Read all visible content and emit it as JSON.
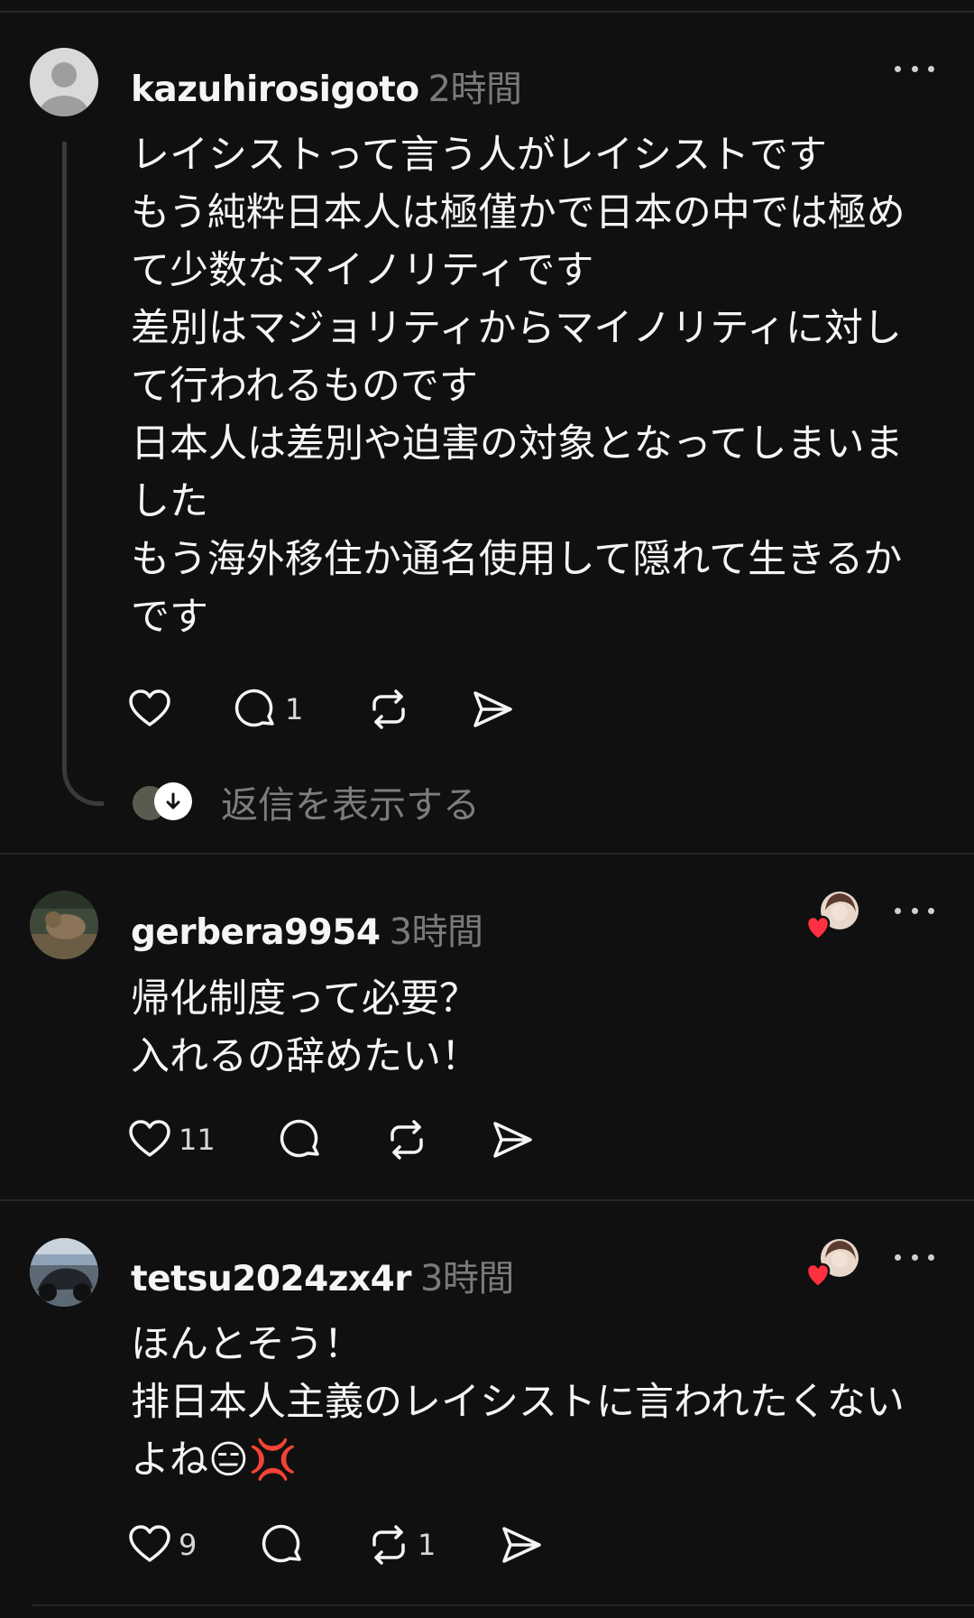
{
  "posts": [
    {
      "username": "kazuhirosigoto",
      "time": "2時間",
      "text": "レイシストって言う人がレイシストです\nもう純粋日本人は極僅かで日本の中では極め\nて少数なマイノリティです\n差別はマジョリティからマイノリティに対し\nて行われるものです\n日本人は差別や迫害の対象となってしまいま\nした\nもう海外移住か通名使用して隠れて生きるか\nです",
      "likes": "",
      "replies": "1",
      "reposts": "",
      "show_replies_label": "返信を表示する"
    },
    {
      "username": "gerbera9954",
      "time": "3時間",
      "text": "帰化制度って必要？\n入れるの辞めたい！",
      "likes": "11",
      "replies": "",
      "reposts": ""
    },
    {
      "username": "tetsu2024zx4r",
      "time": "3時間",
      "text": "ほんとそう！\n排日本人主義のレイシストに言われたくない\nよね😑💢",
      "likes": "9",
      "replies": "",
      "reposts": "1"
    }
  ],
  "icons": [
    "heart-icon",
    "comment-icon",
    "repost-icon",
    "share-icon",
    "more-icon",
    "arrow-down-icon"
  ],
  "colors": {
    "background": "#101010",
    "text": "#f3f5f7",
    "muted": "#7a7a7a",
    "like_red": "#ff3040"
  }
}
